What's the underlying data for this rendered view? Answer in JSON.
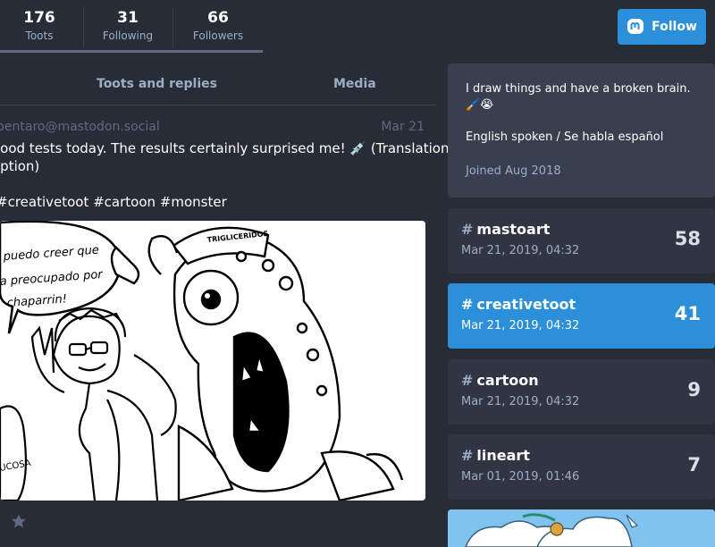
{
  "counters": [
    {
      "value": "176",
      "label": "Toots"
    },
    {
      "value": "31",
      "label": "Following"
    },
    {
      "value": "66",
      "label": "Followers"
    }
  ],
  "follow_button": {
    "label": "Follow",
    "icon": "mastodon-icon"
  },
  "tabs": [
    {
      "label": "Toots and replies"
    },
    {
      "label": "Media"
    }
  ],
  "status": {
    "account": "pentaro@mastodon.social",
    "date": "Mar 21",
    "line1": "lood tests today. The results certainly surprised me! 💉 (Translation in",
    "line2": "iption)",
    "hashtags": "#creativetoot #cartoon #monster",
    "comic_text": "puedo creer que\n a preocupado por\n chaparrin!",
    "cap_text": "TRIGLICERIDOS",
    "bag_text": "UCOSA"
  },
  "profile": {
    "bio": "I draw things and have a broken brain.",
    "bio_emoji": "🖌️😭",
    "languages": "English spoken / Se habla español",
    "joined": "Joined Aug 2018"
  },
  "featured_tags": [
    {
      "name": "mastoart",
      "date": "Mar 21, 2019, 04:32",
      "count": "58",
      "active": false
    },
    {
      "name": "creativetoot",
      "date": "Mar 21, 2019, 04:32",
      "count": "41",
      "active": true
    },
    {
      "name": "cartoon",
      "date": "Mar 21, 2019, 04:32",
      "count": "9",
      "active": false
    },
    {
      "name": "lineart",
      "date": "Mar 01, 2019, 01:46",
      "count": "7",
      "active": false
    }
  ],
  "colors": {
    "background": "#282c37",
    "accent": "#2b90d9",
    "card": "#313543",
    "muted": "#9baec8"
  }
}
